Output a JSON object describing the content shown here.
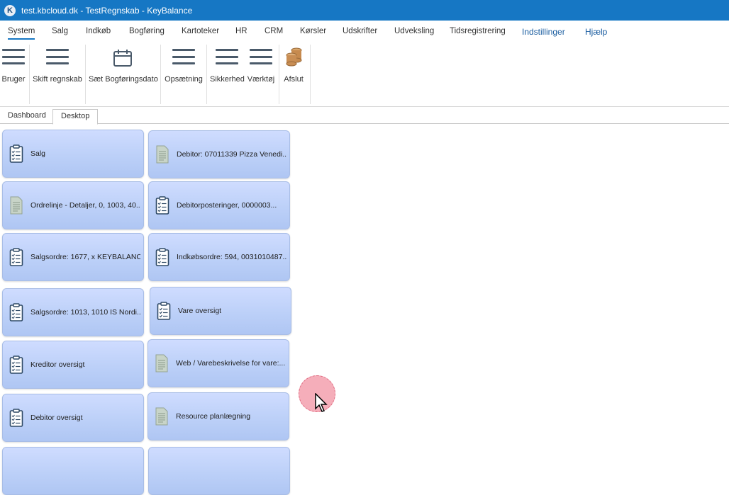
{
  "window": {
    "title": "test.kbcloud.dk - TestRegnskab - KeyBalance",
    "logo_letter": "K"
  },
  "menu": [
    {
      "label": "System",
      "active": true
    },
    {
      "label": "Salg"
    },
    {
      "label": "Indkøb"
    },
    {
      "label": "Bogføring"
    },
    {
      "label": "Kartoteker"
    },
    {
      "label": "HR"
    },
    {
      "label": "CRM"
    },
    {
      "label": "Kørsler"
    },
    {
      "label": "Udskrifter"
    },
    {
      "label": "Udveksling"
    },
    {
      "label": "Tidsregistrering"
    },
    {
      "label": "Indstillinger"
    },
    {
      "label": "Hjælp"
    }
  ],
  "ribbon": [
    {
      "label": "Bruger",
      "icon": "menu-icon"
    },
    {
      "label": "Skift regnskab",
      "icon": "menu-icon"
    },
    {
      "label": "Sæt Bogføringsdato",
      "icon": "calendar-icon"
    },
    {
      "label": "Opsætning",
      "icon": "menu-icon"
    },
    {
      "label": "Sikkerhed",
      "icon": "menu-icon"
    },
    {
      "label": "Værktøj",
      "icon": "menu-icon"
    },
    {
      "label": "Afslut",
      "icon": "coins-icon"
    }
  ],
  "tabs": [
    {
      "label": "Dashboard"
    },
    {
      "label": "Desktop",
      "active": true
    }
  ],
  "tiles": [
    {
      "label": "Salg",
      "icon": "clipboard-icon"
    },
    {
      "label": "Debitor: 07011339 Pizza Venedi...",
      "icon": "document-icon"
    },
    {
      "label": "Ordrelinje - Detaljer, 0, 1003, 40...",
      "icon": "document-icon"
    },
    {
      "label": "Debitorposteringer, 0000003...",
      "icon": "clipboard-icon"
    },
    {
      "label": "Salgsordre: 1677, x KEYBALANC...",
      "icon": "clipboard-icon"
    },
    {
      "label": "Indkøbsordre: 594, 0031010487...",
      "icon": "clipboard-icon"
    },
    {
      "label": "Salgsordre: 1013, 1010 IS Nordi...",
      "icon": "clipboard-icon"
    },
    {
      "label": "Vare oversigt",
      "icon": "clipboard-icon"
    },
    {
      "label": "Kreditor oversigt",
      "icon": "clipboard-icon"
    },
    {
      "label": "Web / Varebeskrivelse for vare:...",
      "icon": "document-icon"
    },
    {
      "label": "Debitor oversigt",
      "icon": "clipboard-icon"
    },
    {
      "label": "Resource planlægning",
      "icon": "document-icon"
    }
  ],
  "colors": {
    "titlebar": "#1677c4",
    "tile": "#bcd0f8",
    "accent": "#1677c4"
  }
}
